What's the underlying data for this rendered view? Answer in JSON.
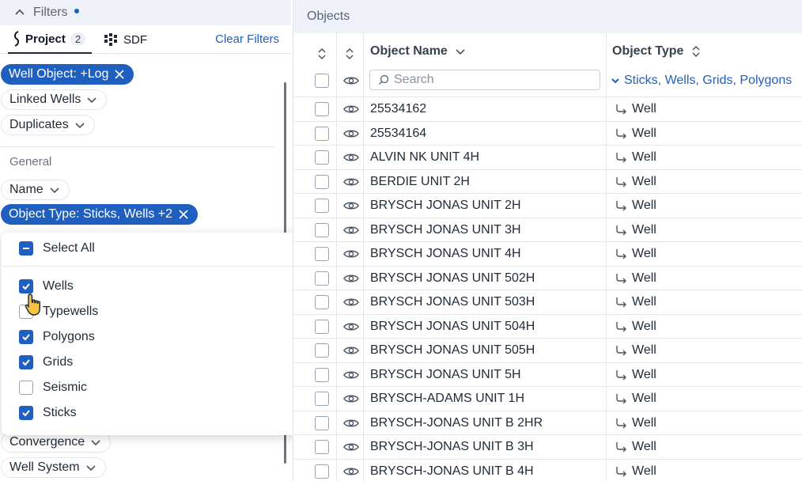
{
  "filters_panel": {
    "title": "Filters",
    "tabs": [
      {
        "label": "Project",
        "count": "2"
      },
      {
        "label": "SDF"
      }
    ],
    "clear_label": "Clear Filters",
    "chips_top": [
      {
        "label": "Well Object: +Log",
        "active": true
      },
      {
        "label": "Linked Wells",
        "active": false
      },
      {
        "label": "Duplicates",
        "active": false
      }
    ],
    "general_title": "General",
    "chips_general": [
      {
        "label": "Name",
        "active": false
      },
      {
        "label": "Object Type: Sticks, Wells +2",
        "active": true
      }
    ],
    "chips_bottom": [
      {
        "label": "Convergence",
        "active": false
      },
      {
        "label": "Well System",
        "active": false
      }
    ]
  },
  "object_type_dropdown": {
    "select_all_label": "Select All",
    "select_all_state": "indeterminate",
    "options": [
      {
        "label": "Wells",
        "checked": true
      },
      {
        "label": "Typewells",
        "checked": false
      },
      {
        "label": "Polygons",
        "checked": true
      },
      {
        "label": "Grids",
        "checked": true
      },
      {
        "label": "Seismic",
        "checked": false
      },
      {
        "label": "Sticks",
        "checked": true
      }
    ]
  },
  "objects_panel": {
    "title": "Objects",
    "columns": {
      "name": "Object Name",
      "type": "Object Type"
    },
    "search_placeholder": "Search",
    "type_filter_label": "Sticks, Wells, Grids, Polygons",
    "rows": [
      {
        "name": "25534162",
        "type": "Well"
      },
      {
        "name": "25534164",
        "type": "Well"
      },
      {
        "name": "ALVIN NK UNIT 4H",
        "type": "Well"
      },
      {
        "name": "BERDIE UNIT 2H",
        "type": "Well"
      },
      {
        "name": "BRYSCH JONAS UNIT 2H",
        "type": "Well"
      },
      {
        "name": "BRYSCH JONAS UNIT 3H",
        "type": "Well"
      },
      {
        "name": "BRYSCH JONAS UNIT 4H",
        "type": "Well"
      },
      {
        "name": "BRYSCH JONAS UNIT 502H",
        "type": "Well"
      },
      {
        "name": "BRYSCH JONAS UNIT 503H",
        "type": "Well"
      },
      {
        "name": "BRYSCH JONAS UNIT 504H",
        "type": "Well"
      },
      {
        "name": "BRYSCH JONAS UNIT 505H",
        "type": "Well"
      },
      {
        "name": "BRYSCH JONAS UNIT 5H",
        "type": "Well"
      },
      {
        "name": "BRYSCH-ADAMS UNIT 1H",
        "type": "Well"
      },
      {
        "name": "BRYSCH-JONAS UNIT B 2HR",
        "type": "Well"
      },
      {
        "name": "BRYSCH-JONAS UNIT B 3H",
        "type": "Well"
      },
      {
        "name": "BRYSCH-JONAS UNIT B 4H",
        "type": "Well"
      }
    ]
  },
  "colors": {
    "accent": "#1f5fbf",
    "header_bg": "#eef2f8"
  }
}
